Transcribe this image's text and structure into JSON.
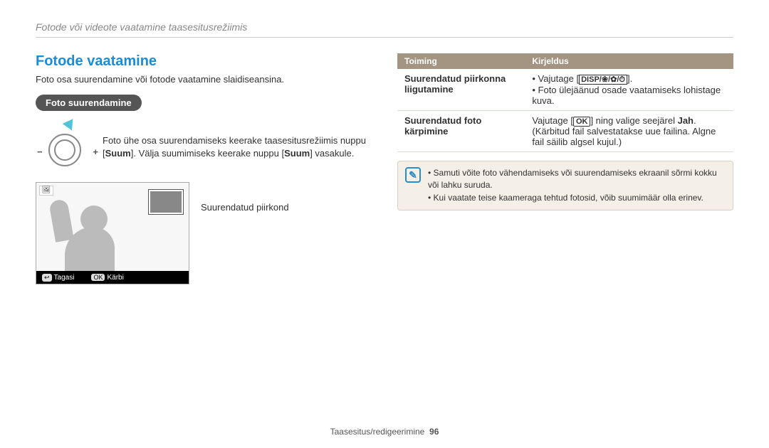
{
  "breadcrumb": "Fotode või videote vaatamine taasesitusrežiimis",
  "left": {
    "title": "Fotode vaatamine",
    "intro": "Foto osa suurendamine või fotode vaatamine slaidiseansina.",
    "pill": "Foto suurendamine",
    "zoom_text_pre": "Foto ühe osa suurendamiseks keerake taasesitusrežiimis nuppu [",
    "zoom_text_b1": "Suum",
    "zoom_text_mid": "]. Välja suumimiseks keerake nuppu [",
    "zoom_text_b2": "Suum",
    "zoom_text_post": "] vasakule.",
    "caption": "Suurendatud piirkond",
    "footer_back_icon": "↩",
    "footer_back": "Tagasi",
    "footer_ok_icon": "OK",
    "footer_ok": "Kärbi"
  },
  "table": {
    "head_action": "Toiming",
    "head_desc": "Kirjeldus",
    "rows": [
      {
        "action": "Suurendatud piirkonna liigutamine",
        "desc_pre": "• Vajutage [",
        "desc_icons": "DISP/❀/✿/⏱",
        "desc_post": "].",
        "desc2": "• Foto ülejäänud osade vaatamiseks lohistage kuva."
      },
      {
        "action": "Suurendatud foto kärpimine",
        "desc_pre": "Vajutage [",
        "desc_ok": "OK",
        "desc_mid": "] ning valige seejärel ",
        "desc_b": "Jah",
        "desc_post": ". (Kärbitud fail salvestatakse uue failina. Algne fail säilib algsel kujul.)"
      }
    ]
  },
  "notes": [
    "Samuti võite foto vähendamiseks või suurendamiseks ekraanil sõrmi kokku või lahku suruda.",
    "Kui vaatate teise kaameraga tehtud fotosid, võib suumimäär olla erinev."
  ],
  "footer": {
    "section": "Taasesitus/redigeerimine",
    "page": "96"
  }
}
